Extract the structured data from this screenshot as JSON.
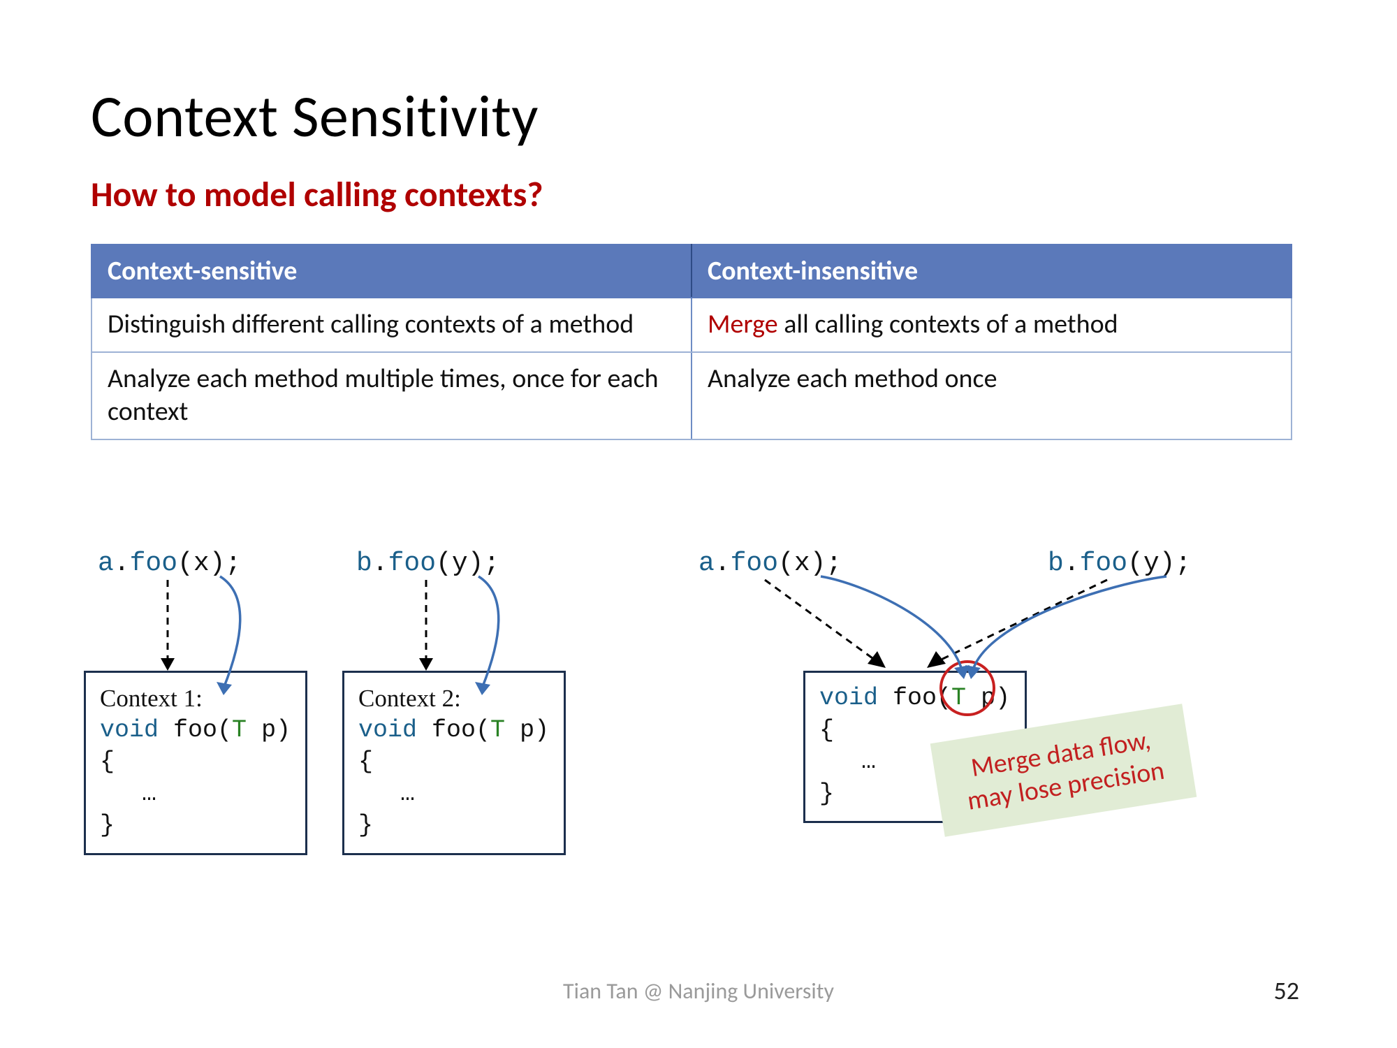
{
  "title": "Context Sensitivity",
  "subtitle": "How to model calling contexts?",
  "table": {
    "headers": [
      "Context-sensitive",
      "Context-insensitive"
    ],
    "rows": [
      {
        "left": "Distinguish different calling contexts of a method",
        "right_prefix": "Merge",
        "right_rest": " all calling contexts of a method"
      },
      {
        "left": "Analyze each method multiple times, once for each context",
        "right": "Analyze each method once"
      }
    ]
  },
  "code": {
    "call_a": "a.foo(x);",
    "call_b": "b.foo(y);",
    "context1_label": "Context 1:",
    "context2_label": "Context 2:",
    "foo_sig_void": "void",
    "foo_sig_name": " foo(",
    "foo_type": "T",
    "foo_param": " p",
    "foo_open": ") {",
    "foo_ellipsis": "…",
    "foo_close": "}"
  },
  "sticky": {
    "line1": "Merge data flow,",
    "line2": "may lose precision"
  },
  "footer": "Tian Tan @ Nanjing University",
  "page": "52"
}
